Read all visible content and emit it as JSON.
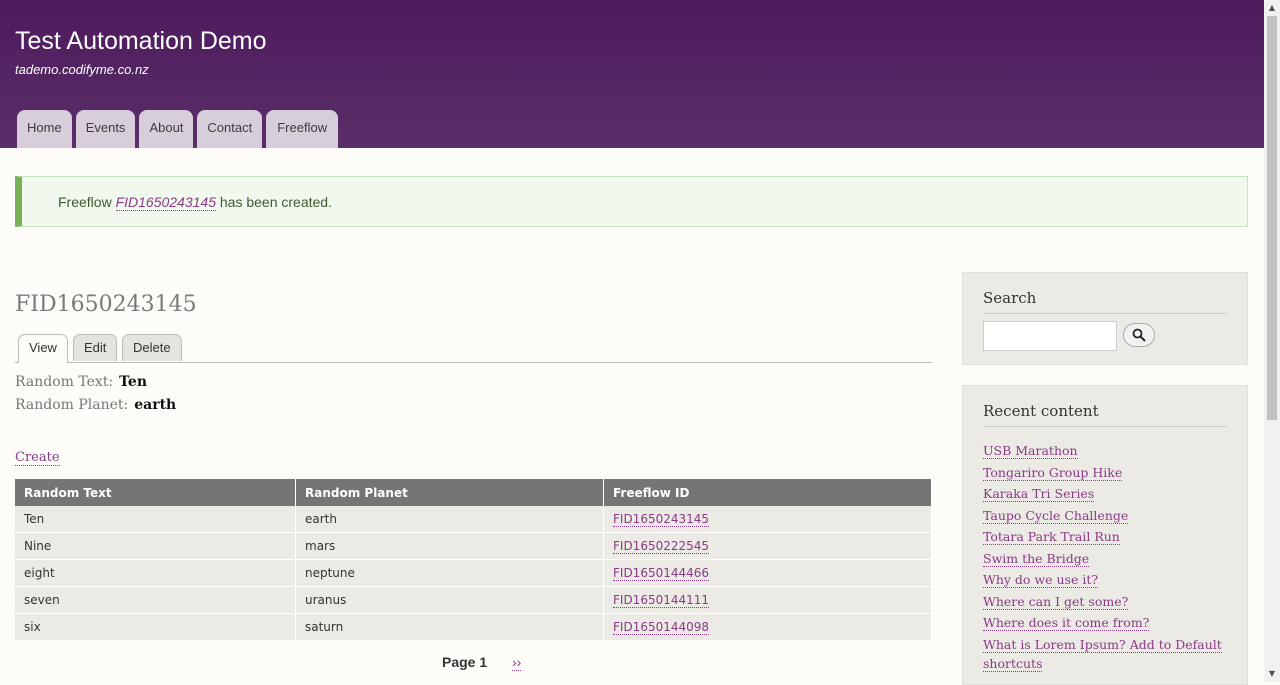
{
  "header": {
    "site_name": "Test Automation Demo",
    "slogan": "tademo.codifyme.co.nz",
    "nav": [
      "Home",
      "Events",
      "About",
      "Contact",
      "Freeflow"
    ]
  },
  "message": {
    "prefix": "Freeflow",
    "link": "FID1650243145",
    "suffix": "has been created."
  },
  "page": {
    "title": "FID1650243145",
    "tabs": [
      "View",
      "Edit",
      "Delete"
    ],
    "fields": [
      {
        "label": "Random Text:",
        "value": "Ten"
      },
      {
        "label": "Random Planet:",
        "value": "earth"
      }
    ],
    "create_link": "Create"
  },
  "table": {
    "headers": [
      "Random Text",
      "Random Planet",
      "Freeflow ID"
    ],
    "rows": [
      [
        "Ten",
        "earth",
        "FID1650243145"
      ],
      [
        "Nine",
        "mars",
        "FID1650222545"
      ],
      [
        "eight",
        "neptune",
        "FID1650144466"
      ],
      [
        "seven",
        "uranus",
        "FID1650144111"
      ],
      [
        "six",
        "saturn",
        "FID1650144098"
      ]
    ]
  },
  "pager": {
    "current": "Page 1",
    "next": "››"
  },
  "sidebar": {
    "search_title": "Search",
    "search_value": "",
    "search_icon": "magnifier-icon",
    "recent_title": "Recent content",
    "recent": [
      "USB Marathon",
      "Tongariro Group Hike",
      "Karaka Tri Series",
      "Taupo Cycle Challenge",
      "Totara Park Trail Run",
      "Swim the Bridge",
      "Why do we use it?",
      "Where can I get some?",
      "Where does it come from?",
      "What is Lorem Ipsum? Add to Default shortcuts"
    ]
  },
  "colors": {
    "header": "#4d1a5c",
    "link": "#8a3a86",
    "message_accent": "#77b259",
    "table_header": "#757575"
  }
}
